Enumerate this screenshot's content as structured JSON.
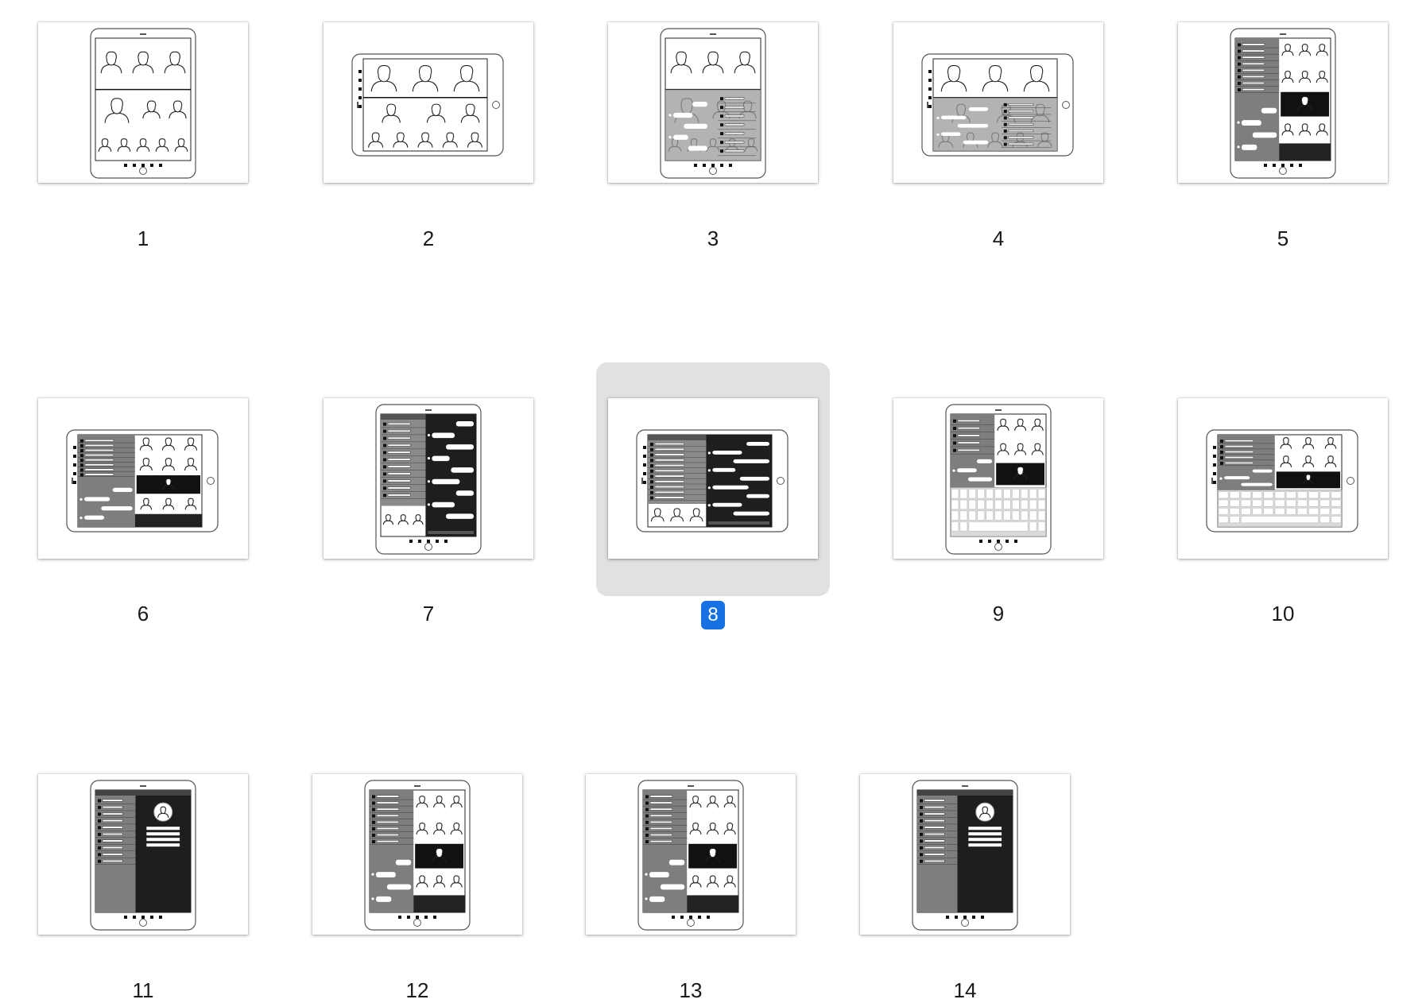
{
  "selected_slide": 8,
  "colors": {
    "selection_badge": "#1672e3",
    "selection_background": "#e1e1e1"
  },
  "slides": [
    {
      "number": "1",
      "orientation": "portrait",
      "layout": "video-grid"
    },
    {
      "number": "2",
      "orientation": "landscape",
      "layout": "video-grid"
    },
    {
      "number": "3",
      "orientation": "portrait",
      "layout": "video-grid-overlay"
    },
    {
      "number": "4",
      "orientation": "landscape",
      "layout": "video-grid-overlay"
    },
    {
      "number": "5",
      "orientation": "portrait",
      "layout": "split-chat-video"
    },
    {
      "number": "6",
      "orientation": "landscape",
      "layout": "split-chat-video"
    },
    {
      "number": "7",
      "orientation": "portrait",
      "layout": "chat-dark"
    },
    {
      "number": "8",
      "orientation": "landscape",
      "layout": "chat-dark"
    },
    {
      "number": "9",
      "orientation": "portrait",
      "layout": "video-keyboard"
    },
    {
      "number": "10",
      "orientation": "landscape",
      "layout": "video-keyboard"
    },
    {
      "number": "11",
      "orientation": "portrait",
      "layout": "profile"
    },
    {
      "number": "12",
      "orientation": "portrait",
      "layout": "split-chat-video"
    },
    {
      "number": "13",
      "orientation": "portrait",
      "layout": "split-chat-video"
    },
    {
      "number": "14",
      "orientation": "portrait",
      "layout": "profile"
    }
  ]
}
